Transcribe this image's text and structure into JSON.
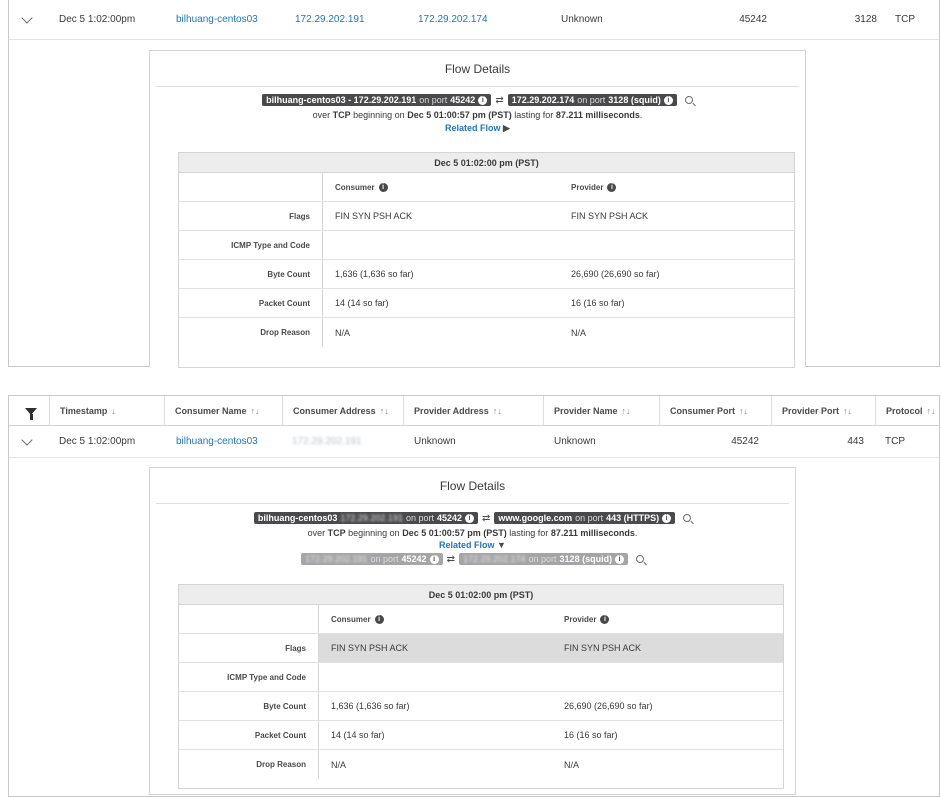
{
  "panel1": {
    "row": {
      "timestamp": "Dec 5 1:02:00pm",
      "consumer_name": "bilhuang-centos03",
      "consumer_address": "172.29.202.191",
      "provider_address": "172.29.202.174",
      "provider_name": "Unknown",
      "consumer_port": "45242",
      "provider_port": "3128",
      "protocol": "TCP"
    },
    "details": {
      "title": "Flow Details",
      "consumer_pill": {
        "name_addr": "bilhuang-centos03 - 172.29.202.191",
        "on_port": "on port",
        "port": "45242"
      },
      "provider_pill": {
        "addr": "172.29.202.174",
        "on_port": "on port",
        "port": "3128 (squid)"
      },
      "summary": {
        "pre": "over",
        "proto": "TCP",
        "mid": "beginning on",
        "start": "Dec 5 01:00:57 pm (PST)",
        "lasting": "lasting for",
        "duration": "87.211 milliseconds",
        "end": "."
      },
      "related_flow": "Related Flow",
      "related_arrow": "▶",
      "table": {
        "header": "Dec 5 01:02:00 pm (PST)",
        "consumer_col": "Consumer",
        "provider_col": "Provider",
        "rows": [
          {
            "label": "Flags",
            "consumer": "FIN SYN PSH ACK",
            "provider": "FIN SYN PSH ACK"
          },
          {
            "label": "ICMP Type and Code",
            "consumer": "",
            "provider": ""
          },
          {
            "label": "Byte Count",
            "consumer": "1,636 (1,636 so far)",
            "provider": "26,690 (26,690 so far)"
          },
          {
            "label": "Packet Count",
            "consumer": "14 (14 so far)",
            "provider": "16 (16 so far)"
          },
          {
            "label": "Drop Reason",
            "consumer": "N/A",
            "provider": "N/A"
          }
        ]
      }
    }
  },
  "panel2": {
    "columns": {
      "timestamp": "Timestamp",
      "timestamp_sort": "↓",
      "consumer_name": "Consumer Name",
      "consumer_address": "Consumer Address",
      "provider_address": "Provider Address",
      "provider_name": "Provider Name",
      "consumer_port": "Consumer Port",
      "provider_port": "Provider Port",
      "protocol": "Protocol",
      "sort_icon": "↑↓"
    },
    "row": {
      "timestamp": "Dec 5 1:02:00pm",
      "consumer_name": "bilhuang-centos03",
      "consumer_address": "172.29.202.191",
      "provider_address": "Unknown",
      "provider_name": "Unknown",
      "consumer_port": "45242",
      "provider_port": "443",
      "protocol": "TCP"
    },
    "details": {
      "title": "Flow Details",
      "consumer_pill": {
        "name": "bilhuang-centos03",
        "addr": "172.29.202.191",
        "on_port": "on port",
        "port": "45242"
      },
      "provider_pill": {
        "addr": "www.google.com",
        "on_port": "on port",
        "port": "443 (HTTPS)"
      },
      "summary": {
        "pre": "over",
        "proto": "TCP",
        "mid": "beginning on",
        "start": "Dec 5 01:00:57 pm (PST)",
        "lasting": "lasting for",
        "duration": "87.211 milliseconds",
        "end": "."
      },
      "related_flow": "Related Flow",
      "related_arrow": "▼",
      "related_consumer": {
        "addr": "172.29.202.191",
        "on_port": "on port",
        "port": "45242"
      },
      "related_provider": {
        "addr": "172.29.202.174",
        "on_port": "on port",
        "port": "3128 (squid)"
      },
      "table": {
        "header": "Dec 5 01:02:00 pm (PST)",
        "consumer_col": "Consumer",
        "provider_col": "Provider",
        "rows": [
          {
            "label": "Flags",
            "consumer": "FIN SYN PSH ACK",
            "provider": "FIN SYN PSH ACK"
          },
          {
            "label": "ICMP Type and Code",
            "consumer": "",
            "provider": ""
          },
          {
            "label": "Byte Count",
            "consumer": "1,636 (1,636 so far)",
            "provider": "26,690 (26,690 so far)"
          },
          {
            "label": "Packet Count",
            "consumer": "14 (14 so far)",
            "provider": "16 (16 so far)"
          },
          {
            "label": "Drop Reason",
            "consumer": "N/A",
            "provider": "N/A"
          }
        ]
      }
    }
  },
  "icons": {
    "info": "i",
    "swap": "⇄"
  },
  "colors": {
    "link": "#1f78b4",
    "pill": "#4a4a4c",
    "pill_grey": "#a5a5a7",
    "highlight_row": "#dcdcdc"
  }
}
